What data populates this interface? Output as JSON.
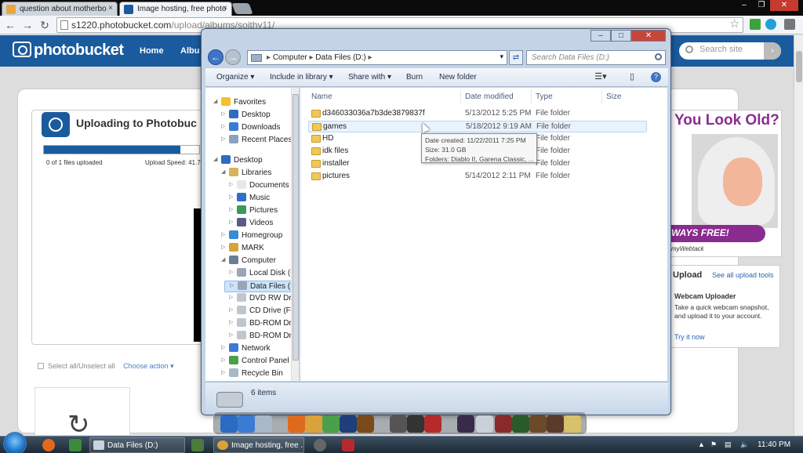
{
  "browser": {
    "tabs": [
      {
        "title": "question about motherbo"
      },
      {
        "title": "Image hosting, free photo"
      }
    ],
    "url_host": "s1220.photobucket.com",
    "url_path": "/upload/albums/soithy11/"
  },
  "photobucket": {
    "logo": "photobucket",
    "nav": [
      "Home",
      "Albu"
    ],
    "search_placeholder": "Search site",
    "upload_title": "Uploading to Photobuc",
    "progress": 0.88,
    "files_status": "0 of 1 files uploaded",
    "upload_speed": "Upload Speed: 41.7",
    "select_all": "Select all/Unselect all",
    "choose_action": "Choose action ▾",
    "ad_headline": "You Look Old?",
    "ad_banner": "WAYS FREE!",
    "ad_brand": "myWebtack",
    "upload_header": "Upload",
    "upload_tools_link": "See all upload tools",
    "webcam_title": "Webcam Uploader",
    "webcam_desc": "Take a quick webcam snapshot, and upload it to your account.",
    "try_now": "Try it now"
  },
  "explorer": {
    "breadcrumb": [
      "Computer",
      "Data Files (D:)"
    ],
    "search_placeholder": "Search Data Files (D:)",
    "commands": [
      "Organize ▾",
      "Include in library ▾",
      "Share with ▾",
      "Burn",
      "New folder"
    ],
    "nav_tree": [
      {
        "label": "Favorites",
        "icon": "star-icon",
        "level": 0,
        "expanded": true
      },
      {
        "label": "Desktop",
        "icon": "desktop-icon",
        "level": 1
      },
      {
        "label": "Downloads",
        "icon": "downloads-icon",
        "level": 1
      },
      {
        "label": "Recent Places",
        "icon": "recent-places-icon",
        "level": 1
      },
      {
        "label": "Desktop",
        "icon": "desktop-icon",
        "level": 0,
        "expanded": true
      },
      {
        "label": "Libraries",
        "icon": "libraries-icon",
        "level": 1,
        "expanded": true
      },
      {
        "label": "Documents",
        "icon": "documents-icon",
        "level": 2
      },
      {
        "label": "Music",
        "icon": "music-icon",
        "level": 2
      },
      {
        "label": "Pictures",
        "icon": "pictures-icon",
        "level": 2
      },
      {
        "label": "Videos",
        "icon": "videos-icon",
        "level": 2
      },
      {
        "label": "Homegroup",
        "icon": "homegroup-icon",
        "level": 1
      },
      {
        "label": "MARK",
        "icon": "user-icon",
        "level": 1
      },
      {
        "label": "Computer",
        "icon": "computer-icon",
        "level": 1,
        "expanded": true
      },
      {
        "label": "Local Disk (C:)",
        "icon": "disk-icon",
        "level": 2
      },
      {
        "label": "Data Files (D:)",
        "icon": "disk-icon",
        "level": 2,
        "selected": true
      },
      {
        "label": "DVD RW Drive (",
        "icon": "dvd-icon",
        "level": 2
      },
      {
        "label": "CD Drive (F:)",
        "icon": "cd-icon",
        "level": 2
      },
      {
        "label": "BD-ROM Drive",
        "icon": "bd-icon",
        "level": 2
      },
      {
        "label": "BD-ROM Drive",
        "icon": "bd-icon",
        "level": 2
      },
      {
        "label": "Network",
        "icon": "network-icon",
        "level": 1
      },
      {
        "label": "Control Panel",
        "icon": "control-panel-icon",
        "level": 1
      },
      {
        "label": "Recycle Bin",
        "icon": "recycle-bin-icon",
        "level": 1
      }
    ],
    "columns": [
      "Name",
      "Date modified",
      "Type",
      "Size"
    ],
    "rows": [
      {
        "name": "d346033036a7b3de3879837f",
        "date": "5/13/2012 5:25 PM",
        "type": "File folder"
      },
      {
        "name": "games",
        "date": "5/18/2012 9:19 AM",
        "type": "File folder"
      },
      {
        "name": "HD",
        "date": "",
        "type": "File folder"
      },
      {
        "name": "idk files",
        "date": "",
        "type": "File folder"
      },
      {
        "name": "installer",
        "date": "",
        "type": "File folder"
      },
      {
        "name": "pictures",
        "date": "5/14/2012 2:11 PM",
        "type": "File folder"
      }
    ],
    "tooltip": {
      "created": "Date created: 11/22/2011 7:25 PM",
      "size": "Size: 31.0 GB",
      "folders": "Folders: Diablo II, Garena Classic, ..."
    },
    "item_count": "6 items"
  },
  "taskbar": {
    "buttons": [
      "Data Files (D:)",
      "Image hosting, free ..."
    ],
    "clock": "11:40 PM"
  },
  "colors": {
    "photobucket_blue": "#1a5b9e",
    "ad_purple": "#8a2c8f",
    "explorer_frame": "#c4d4e6"
  }
}
